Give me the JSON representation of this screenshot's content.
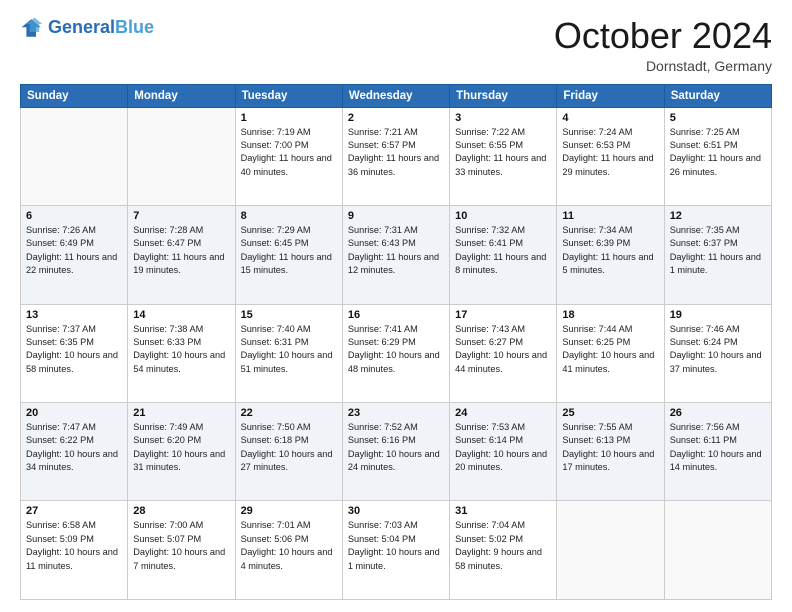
{
  "header": {
    "logo_line1": "General",
    "logo_line2": "Blue",
    "month": "October 2024",
    "location": "Dornstadt, Germany"
  },
  "weekdays": [
    "Sunday",
    "Monday",
    "Tuesday",
    "Wednesday",
    "Thursday",
    "Friday",
    "Saturday"
  ],
  "rows": [
    [
      {
        "day": "",
        "info": ""
      },
      {
        "day": "",
        "info": ""
      },
      {
        "day": "1",
        "info": "Sunrise: 7:19 AM\nSunset: 7:00 PM\nDaylight: 11 hours and 40 minutes."
      },
      {
        "day": "2",
        "info": "Sunrise: 7:21 AM\nSunset: 6:57 PM\nDaylight: 11 hours and 36 minutes."
      },
      {
        "day": "3",
        "info": "Sunrise: 7:22 AM\nSunset: 6:55 PM\nDaylight: 11 hours and 33 minutes."
      },
      {
        "day": "4",
        "info": "Sunrise: 7:24 AM\nSunset: 6:53 PM\nDaylight: 11 hours and 29 minutes."
      },
      {
        "day": "5",
        "info": "Sunrise: 7:25 AM\nSunset: 6:51 PM\nDaylight: 11 hours and 26 minutes."
      }
    ],
    [
      {
        "day": "6",
        "info": "Sunrise: 7:26 AM\nSunset: 6:49 PM\nDaylight: 11 hours and 22 minutes."
      },
      {
        "day": "7",
        "info": "Sunrise: 7:28 AM\nSunset: 6:47 PM\nDaylight: 11 hours and 19 minutes."
      },
      {
        "day": "8",
        "info": "Sunrise: 7:29 AM\nSunset: 6:45 PM\nDaylight: 11 hours and 15 minutes."
      },
      {
        "day": "9",
        "info": "Sunrise: 7:31 AM\nSunset: 6:43 PM\nDaylight: 11 hours and 12 minutes."
      },
      {
        "day": "10",
        "info": "Sunrise: 7:32 AM\nSunset: 6:41 PM\nDaylight: 11 hours and 8 minutes."
      },
      {
        "day": "11",
        "info": "Sunrise: 7:34 AM\nSunset: 6:39 PM\nDaylight: 11 hours and 5 minutes."
      },
      {
        "day": "12",
        "info": "Sunrise: 7:35 AM\nSunset: 6:37 PM\nDaylight: 11 hours and 1 minute."
      }
    ],
    [
      {
        "day": "13",
        "info": "Sunrise: 7:37 AM\nSunset: 6:35 PM\nDaylight: 10 hours and 58 minutes."
      },
      {
        "day": "14",
        "info": "Sunrise: 7:38 AM\nSunset: 6:33 PM\nDaylight: 10 hours and 54 minutes."
      },
      {
        "day": "15",
        "info": "Sunrise: 7:40 AM\nSunset: 6:31 PM\nDaylight: 10 hours and 51 minutes."
      },
      {
        "day": "16",
        "info": "Sunrise: 7:41 AM\nSunset: 6:29 PM\nDaylight: 10 hours and 48 minutes."
      },
      {
        "day": "17",
        "info": "Sunrise: 7:43 AM\nSunset: 6:27 PM\nDaylight: 10 hours and 44 minutes."
      },
      {
        "day": "18",
        "info": "Sunrise: 7:44 AM\nSunset: 6:25 PM\nDaylight: 10 hours and 41 minutes."
      },
      {
        "day": "19",
        "info": "Sunrise: 7:46 AM\nSunset: 6:24 PM\nDaylight: 10 hours and 37 minutes."
      }
    ],
    [
      {
        "day": "20",
        "info": "Sunrise: 7:47 AM\nSunset: 6:22 PM\nDaylight: 10 hours and 34 minutes."
      },
      {
        "day": "21",
        "info": "Sunrise: 7:49 AM\nSunset: 6:20 PM\nDaylight: 10 hours and 31 minutes."
      },
      {
        "day": "22",
        "info": "Sunrise: 7:50 AM\nSunset: 6:18 PM\nDaylight: 10 hours and 27 minutes."
      },
      {
        "day": "23",
        "info": "Sunrise: 7:52 AM\nSunset: 6:16 PM\nDaylight: 10 hours and 24 minutes."
      },
      {
        "day": "24",
        "info": "Sunrise: 7:53 AM\nSunset: 6:14 PM\nDaylight: 10 hours and 20 minutes."
      },
      {
        "day": "25",
        "info": "Sunrise: 7:55 AM\nSunset: 6:13 PM\nDaylight: 10 hours and 17 minutes."
      },
      {
        "day": "26",
        "info": "Sunrise: 7:56 AM\nSunset: 6:11 PM\nDaylight: 10 hours and 14 minutes."
      }
    ],
    [
      {
        "day": "27",
        "info": "Sunrise: 6:58 AM\nSunset: 5:09 PM\nDaylight: 10 hours and 11 minutes."
      },
      {
        "day": "28",
        "info": "Sunrise: 7:00 AM\nSunset: 5:07 PM\nDaylight: 10 hours and 7 minutes."
      },
      {
        "day": "29",
        "info": "Sunrise: 7:01 AM\nSunset: 5:06 PM\nDaylight: 10 hours and 4 minutes."
      },
      {
        "day": "30",
        "info": "Sunrise: 7:03 AM\nSunset: 5:04 PM\nDaylight: 10 hours and 1 minute."
      },
      {
        "day": "31",
        "info": "Sunrise: 7:04 AM\nSunset: 5:02 PM\nDaylight: 9 hours and 58 minutes."
      },
      {
        "day": "",
        "info": ""
      },
      {
        "day": "",
        "info": ""
      }
    ]
  ]
}
